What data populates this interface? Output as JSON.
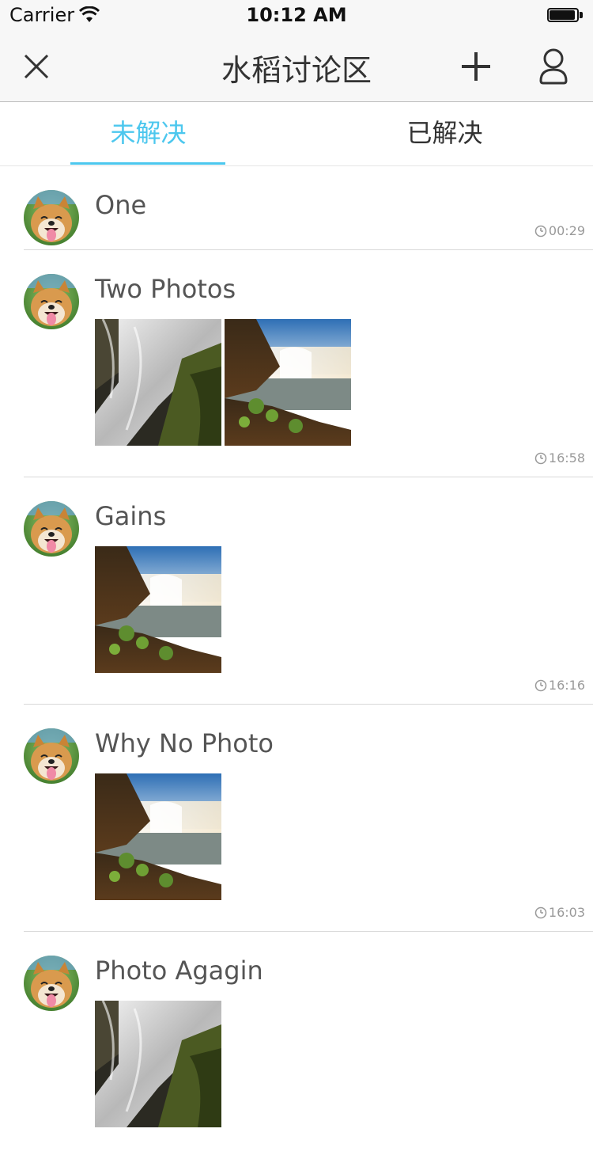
{
  "status_bar": {
    "carrier": "Carrier",
    "time": "10:12 AM"
  },
  "nav": {
    "title": "水稻讨论区",
    "icons": [
      "close-icon",
      "plus-icon",
      "user-icon"
    ]
  },
  "tabs": [
    {
      "label": "未解决",
      "active": true
    },
    {
      "label": "已解决",
      "active": false
    }
  ],
  "colors": {
    "accent": "#4cc7ee",
    "nav_bg": "#f7f7f7",
    "text": "#333333",
    "meta": "#999999"
  },
  "posts": [
    {
      "title": "One",
      "time": "00:29",
      "photos": []
    },
    {
      "title": "Two Photos",
      "time": "16:58",
      "photos": [
        "waterfall-closeup",
        "waterfall-landscape"
      ]
    },
    {
      "title": "Gains",
      "time": "16:16",
      "photos": [
        "waterfall-landscape"
      ]
    },
    {
      "title": "Why No Photo",
      "time": "16:03",
      "photos": [
        "waterfall-landscape"
      ]
    },
    {
      "title": "Photo Agagin",
      "time": "",
      "photos": [
        "waterfall-closeup"
      ]
    }
  ]
}
